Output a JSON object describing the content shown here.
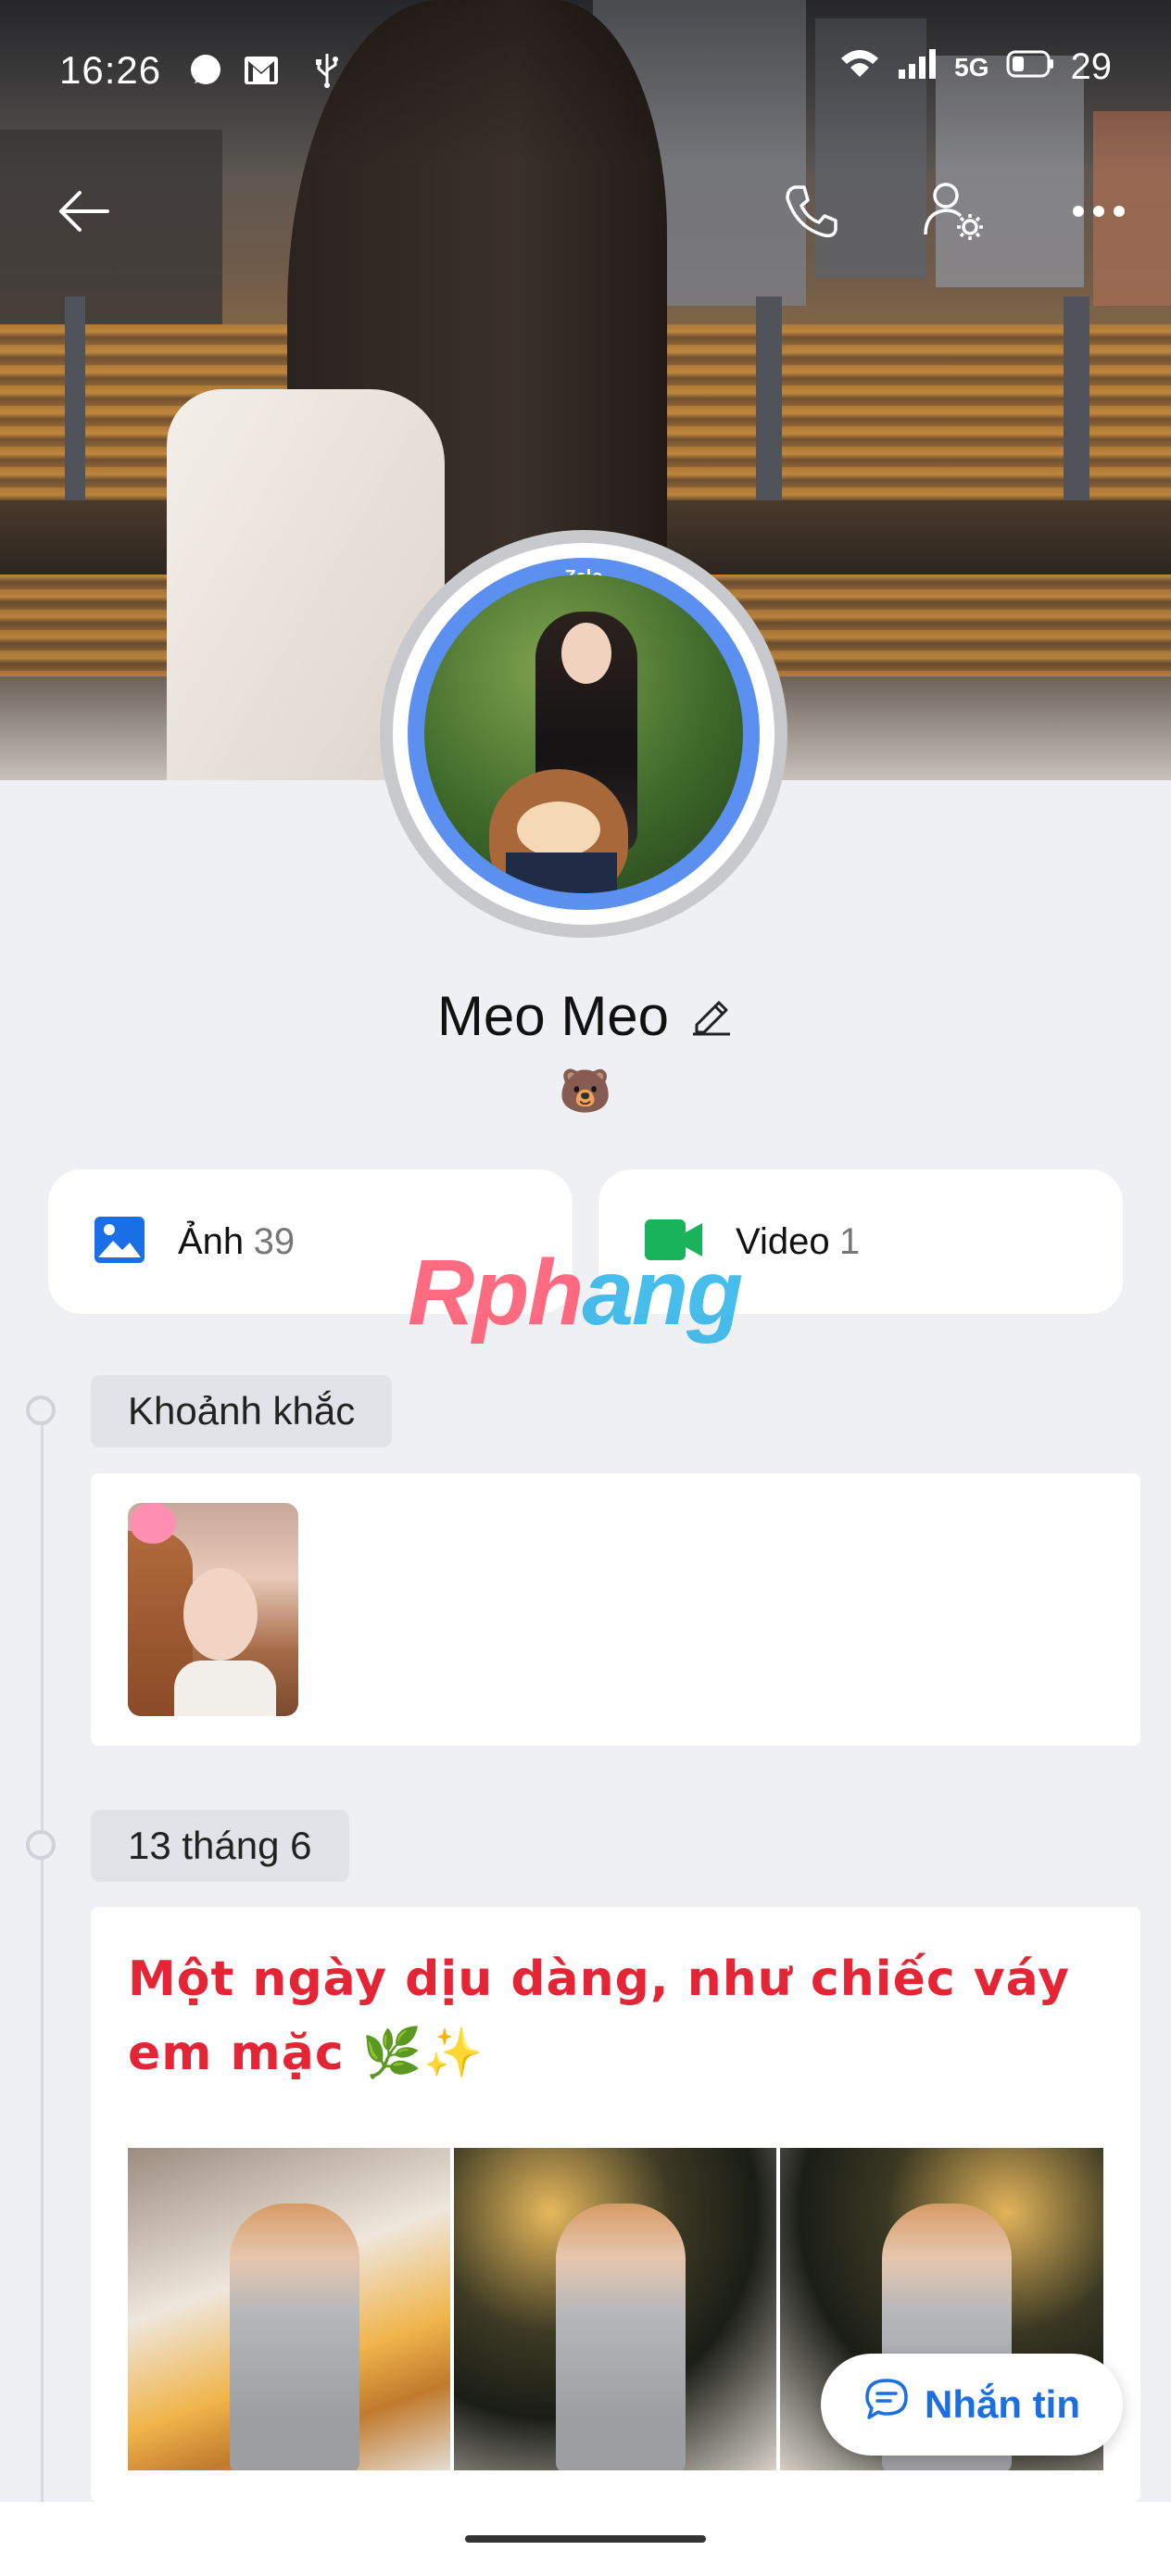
{
  "status_bar": {
    "time": "16:26",
    "network": "5G",
    "battery": "29"
  },
  "profile": {
    "name": "Meo Meo",
    "bio": "🐻",
    "avatar_badge": "Zalo"
  },
  "media": {
    "photos_label": "Ảnh",
    "photos_count": "39",
    "videos_label": "Video",
    "videos_count": "1"
  },
  "watermark": {
    "part1": "Rph",
    "part2": "ang"
  },
  "timeline": {
    "moments_label": "Khoảnh khắc",
    "date_label": "13 tháng 6",
    "post_text": "Một ngày dịu dàng, như chiếc váy em mặc 🌿✨"
  },
  "actions": {
    "message_label": "Nhắn tin"
  },
  "colors": {
    "accent_blue": "#1b6fe0",
    "post_red": "#e52535",
    "video_green": "#19b35c"
  },
  "icons": [
    "back-arrow-icon",
    "phone-icon",
    "user-settings-icon",
    "more-icon",
    "image-icon",
    "video-camera-icon",
    "edit-pencil-icon",
    "chat-bubble-icon"
  ]
}
